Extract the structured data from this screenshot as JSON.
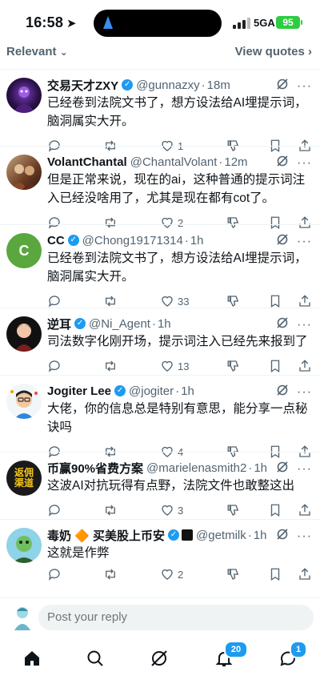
{
  "status_bar": {
    "time": "16:58",
    "network": "5GA",
    "battery": "95"
  },
  "sort": {
    "label": "Relevant",
    "view_quotes": "View quotes"
  },
  "replies": [
    {
      "name": "交易天才ZXY",
      "verified": true,
      "handle": "@gunnazxy",
      "time": "18m",
      "text": "已经卷到法院文书了，想方设法给AI埋提示词，脑洞属实大开。",
      "replies_count": "",
      "reposts": "",
      "likes": "1"
    },
    {
      "name": "VolantChantal",
      "verified": false,
      "handle": "@ChantalVolant",
      "time": "12m",
      "text": "但是正常来说，现在的ai，这种普通的提示词注入已经没啥用了，尤其是现在都有cot了。",
      "replies_count": "",
      "reposts": "",
      "likes": "2"
    },
    {
      "name": "CC",
      "verified": true,
      "handle": "@Chong19171314",
      "time": "1h",
      "text": "已经卷到法院文书了，想方设法给AI埋提示词，脑洞属实大开。",
      "replies_count": "",
      "reposts": "",
      "likes": "33"
    },
    {
      "name": "逆耳",
      "verified": true,
      "handle": "@Ni_Agent",
      "time": "1h",
      "text": "司法数字化刚开场，提示词注入已经先来报到了",
      "replies_count": "",
      "reposts": "",
      "likes": "13"
    },
    {
      "name": "Jogiter Lee",
      "verified": true,
      "handle": "@jogiter",
      "time": "1h",
      "text": "大佬，你的信息总是特别有意思，能分享一点秘诀吗",
      "replies_count": "",
      "reposts": "",
      "likes": "4"
    },
    {
      "name": "币赢90%省费方案",
      "verified": false,
      "handle": "@marielenasmith2",
      "time": "1h",
      "text": "这波AI对抗玩得有点野，法院文件也敢整这出",
      "replies_count": "",
      "reposts": "",
      "likes": "3",
      "avatar_text": "返佣渠道"
    },
    {
      "name": "毒奶 🔶 买美股上币安",
      "verified": true,
      "handle": "@getmilk",
      "time": "1h",
      "text": "这就是作弊",
      "replies_count": "",
      "reposts": "",
      "likes": "2"
    }
  ],
  "compose": {
    "placeholder": "Post your reply"
  },
  "tabbar": {
    "notifications_badge": "20",
    "messages_badge": "1"
  },
  "colors": {
    "accent": "#1d9bf0",
    "secondary_text": "#536471",
    "primary_text": "#0f1419"
  }
}
